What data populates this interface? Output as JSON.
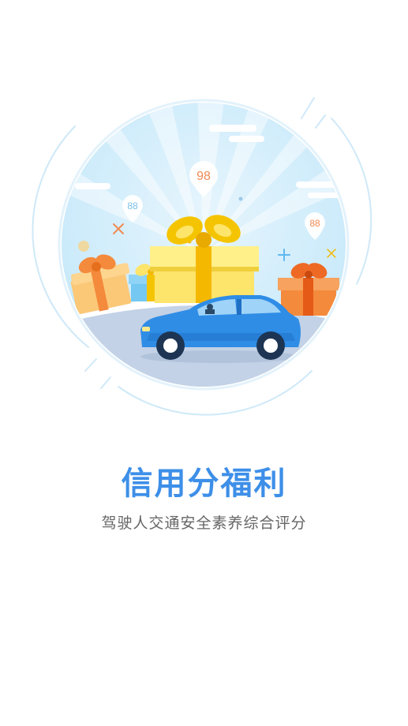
{
  "onboarding": {
    "title": "信用分福利",
    "subtitle": "驾驶人交通安全素养综合评分"
  },
  "illustration": {
    "score_badges": [
      "98",
      "88",
      "88"
    ],
    "colors": {
      "sky_light": "#e6f5fd",
      "sky_mid": "#cdeefb",
      "ring": "#cfe9f8",
      "road": "#c3d2e6",
      "car_body": "#2f8de6",
      "car_dark": "#1f6fc4",
      "gift_yellow": "#fde46a",
      "gift_ribbon": "#f5b800",
      "gift_orange": "#f48a3c",
      "gift_blue": "#74c8f2",
      "badge_text": "#f08a54"
    }
  }
}
